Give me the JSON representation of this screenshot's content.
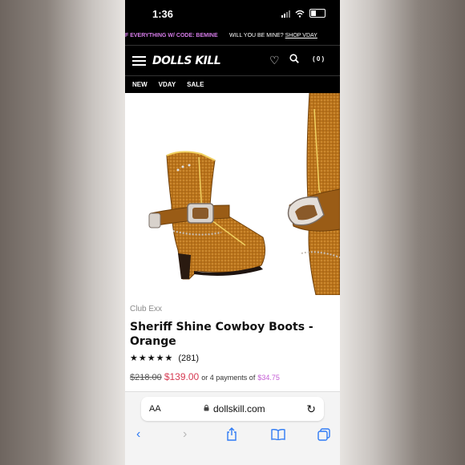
{
  "status_bar": {
    "time": "1:36"
  },
  "promo": {
    "left_text": "F EVERYTHING W/ CODE: BEMINE",
    "right_text": "WILL YOU BE MINE?",
    "right_link": "SHOP VDAY"
  },
  "header": {
    "logo": "DOLLS KILL",
    "cart_count": "( 0 )"
  },
  "nav": {
    "items": [
      "NEW",
      "VDAY",
      "SALE"
    ]
  },
  "product": {
    "brand": "Club Exx",
    "title": "Sheriff Shine Cowboy Boots - Orange",
    "stars": "★★★★★",
    "rating_count": "(281)",
    "old_price": "$218.00",
    "new_price": "$139.00",
    "payment_text": "or 4 payments of",
    "payment_amount": "$34.75",
    "rating_value": 5
  },
  "browser": {
    "aa": "AA",
    "url": "dollskill.com",
    "icons": [
      "back-icon",
      "forward-icon",
      "share-icon",
      "bookmarks-icon",
      "tabs-icon"
    ]
  },
  "colors": {
    "sale_price": "#d63a52",
    "payment_amount": "#c35bd4",
    "promo_code": "#d57be8",
    "browser_accent": "#2f7bf5"
  }
}
